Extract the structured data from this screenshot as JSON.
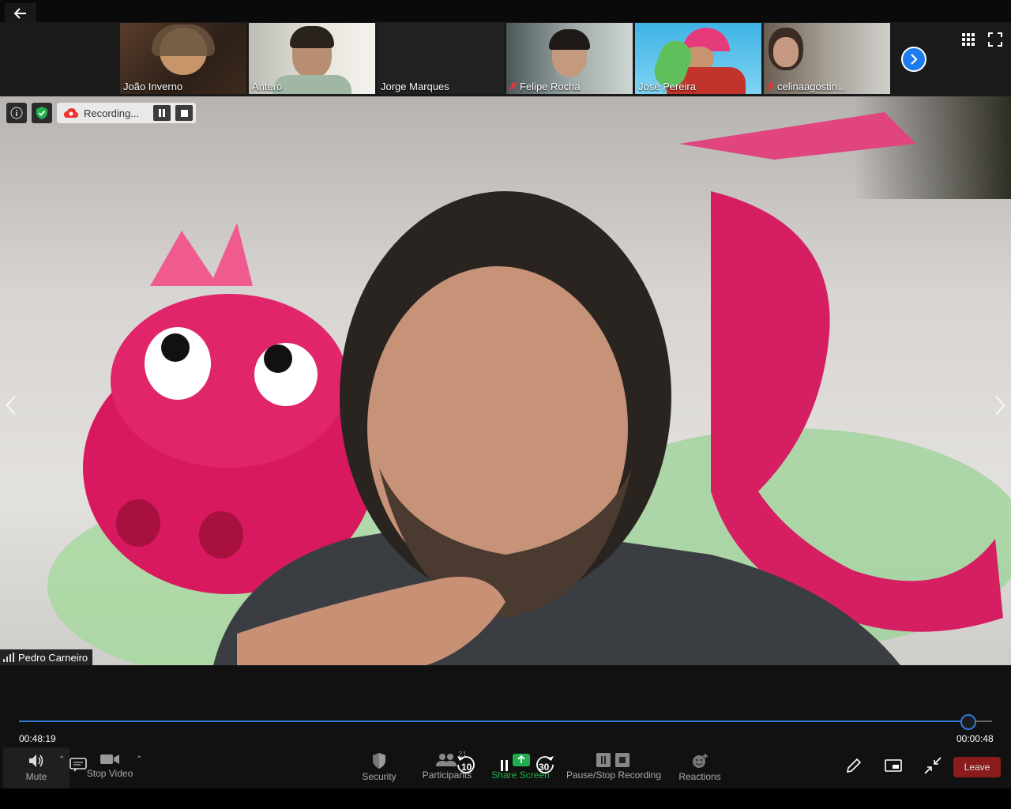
{
  "participants": [
    {
      "name": "João Inverno",
      "muted": false
    },
    {
      "name": "Antero",
      "muted": false
    },
    {
      "name": "Jorge Marques",
      "muted": false
    },
    {
      "name": "Felipe Rocha",
      "muted": true
    },
    {
      "name": "José Pereira",
      "muted": false
    },
    {
      "name": "celinaagostin...",
      "muted": true
    }
  ],
  "recording": {
    "label": "Recording..."
  },
  "speaker": {
    "name": "Pedro Carneiro"
  },
  "player": {
    "elapsed": "00:48:19",
    "remaining": "00:00:48",
    "progress": 0.976
  },
  "toolbar": {
    "mute": "Mute",
    "stop_video": "Stop Video",
    "security": "Security",
    "participants": "Participants",
    "participants_count": "21",
    "share_screen": "Share Screen",
    "pause_stop_recording": "Pause/Stop Recording",
    "reactions": "Reactions",
    "leave": "Leave",
    "rewind": "10",
    "forward": "30"
  },
  "colors": {
    "accent": "#2f7bd8",
    "share_green": "#1fae4b",
    "leave_red": "#8a1c1c"
  }
}
